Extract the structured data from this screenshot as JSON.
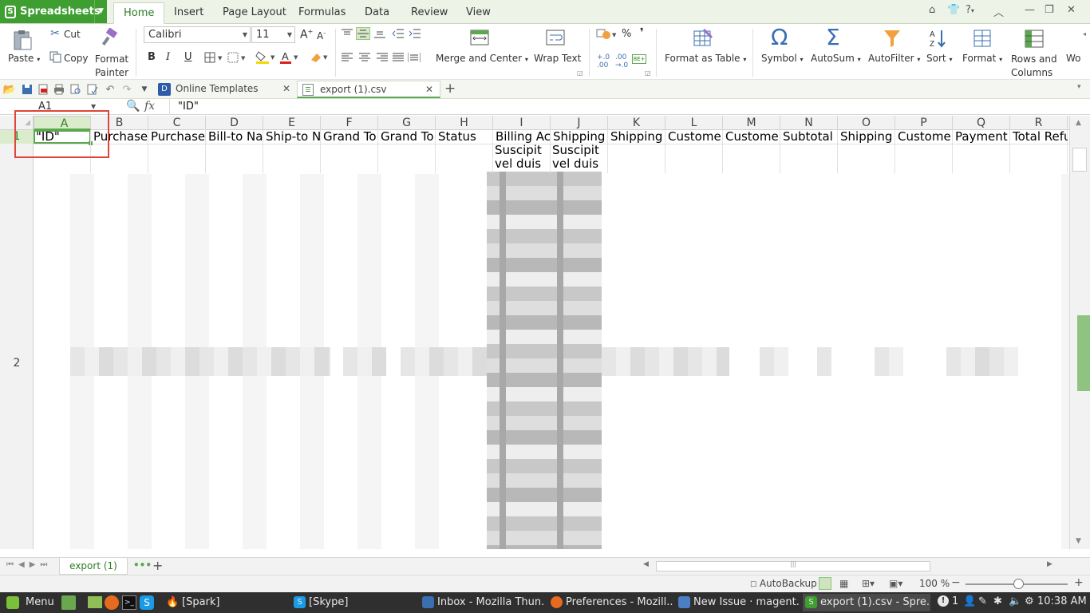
{
  "app": {
    "name": "Spreadsheets"
  },
  "menu_tabs": [
    "Home",
    "Insert",
    "Page Layout",
    "Formulas",
    "Data",
    "Review",
    "View"
  ],
  "window_controls": {
    "help": "?"
  },
  "ribbon": {
    "paste": "Paste",
    "cut": "Cut",
    "copy": "Copy",
    "format_painter": "Format Painter",
    "font_name": "Calibri",
    "font_size": "11",
    "bold": "B",
    "italic": "I",
    "underline": "U",
    "merge_center": "Merge and Center",
    "wrap_text": "Wrap Text",
    "percent": "%",
    "comma": "❜",
    "format_as_table": "Format as Table",
    "symbol": "Symbol",
    "autosum": "AutoSum",
    "autofilter": "AutoFilter",
    "sort": "Sort",
    "format": "Format",
    "rows_columns": "Rows and Columns",
    "worksheet_cut": "Wo"
  },
  "doc_tabs": [
    {
      "label": "Online Templates"
    },
    {
      "label": "export (1).csv"
    }
  ],
  "formula_bar": {
    "name_box": "A1",
    "fx": "fx",
    "content": "\"ID\""
  },
  "columns": [
    "A",
    "B",
    "C",
    "D",
    "E",
    "F",
    "G",
    "H",
    "I",
    "J",
    "K",
    "L",
    "M",
    "N",
    "O",
    "P",
    "Q",
    "R"
  ],
  "rows": [
    "1",
    "2"
  ],
  "row1": [
    "\"ID\"",
    "Purchase",
    "Purchase",
    "Bill-to Na",
    "Ship-to N",
    "Grand To",
    "Grand To",
    "Status",
    "Billing Ac",
    "Shipping",
    "Shipping",
    "Custome",
    "Custome",
    "Subtotal",
    "Shipping",
    "Custome",
    "Payment",
    "Total Refu"
  ],
  "wrapped": {
    "i": [
      "Suscipit",
      "vel duis"
    ],
    "j": [
      "Suscipit",
      "vel duis"
    ]
  },
  "sheet": {
    "tab": "export (1)"
  },
  "status": {
    "autobackup": "AutoBackup",
    "zoom": "100 %"
  },
  "taskbar": {
    "menu": "Menu",
    "items": [
      "[Spark]",
      "[Skype]",
      "Inbox - Mozilla Thun...",
      "Preferences - Mozill...",
      "New Issue · magent...",
      "export (1).csv - Spre..."
    ],
    "tray_num": "1",
    "clock": "10:38 AM"
  },
  "colors": {
    "accent": "#3f9e32",
    "highlight": "#e0443a"
  }
}
